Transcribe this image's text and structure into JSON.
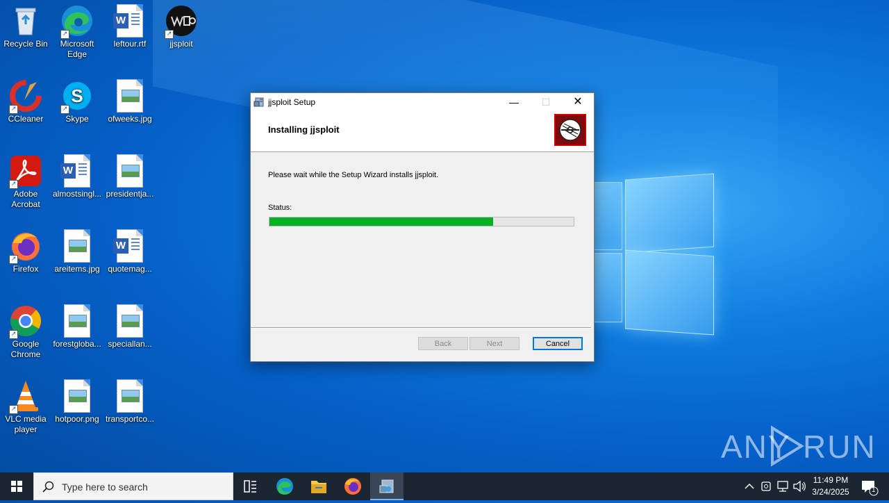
{
  "desktop": {
    "icons": [
      {
        "label": "Recycle Bin"
      },
      {
        "label": "Microsoft Edge"
      },
      {
        "label": "leftour.rtf"
      },
      {
        "label": "jjsploit"
      },
      {
        "label": "CCleaner"
      },
      {
        "label": "Skype"
      },
      {
        "label": "ofweeks.jpg"
      },
      {
        "label": "Adobe Acrobat"
      },
      {
        "label": "almostsingl..."
      },
      {
        "label": "presidentja..."
      },
      {
        "label": "Firefox"
      },
      {
        "label": "areitems.jpg"
      },
      {
        "label": "quotemag..."
      },
      {
        "label": "Google Chrome"
      },
      {
        "label": "forestgloba..."
      },
      {
        "label": "speciallan..."
      },
      {
        "label": "VLC media player"
      },
      {
        "label": "hotpoor.png"
      },
      {
        "label": "transportco..."
      }
    ]
  },
  "dialog": {
    "title": "jjsploit Setup",
    "heading": "Installing jjsploit",
    "message": "Please wait while the Setup Wizard installs jjsploit.",
    "status_label": "Status:",
    "progress": 0.735,
    "buttons": {
      "back": "Back",
      "next": "Next",
      "cancel": "Cancel"
    },
    "controls": {
      "minimize": "—",
      "maximize": "☐",
      "close": "✕"
    }
  },
  "watermark": {
    "left": "ANY",
    "right": "RUN"
  },
  "taskbar": {
    "search_placeholder": "Type here to search",
    "time": "11:49 PM",
    "date": "3/24/2025",
    "notification_count": "1"
  },
  "colors": {
    "progress_fill": "#06b025",
    "accent": "#0078d7",
    "taskbar": "#1c2633"
  }
}
